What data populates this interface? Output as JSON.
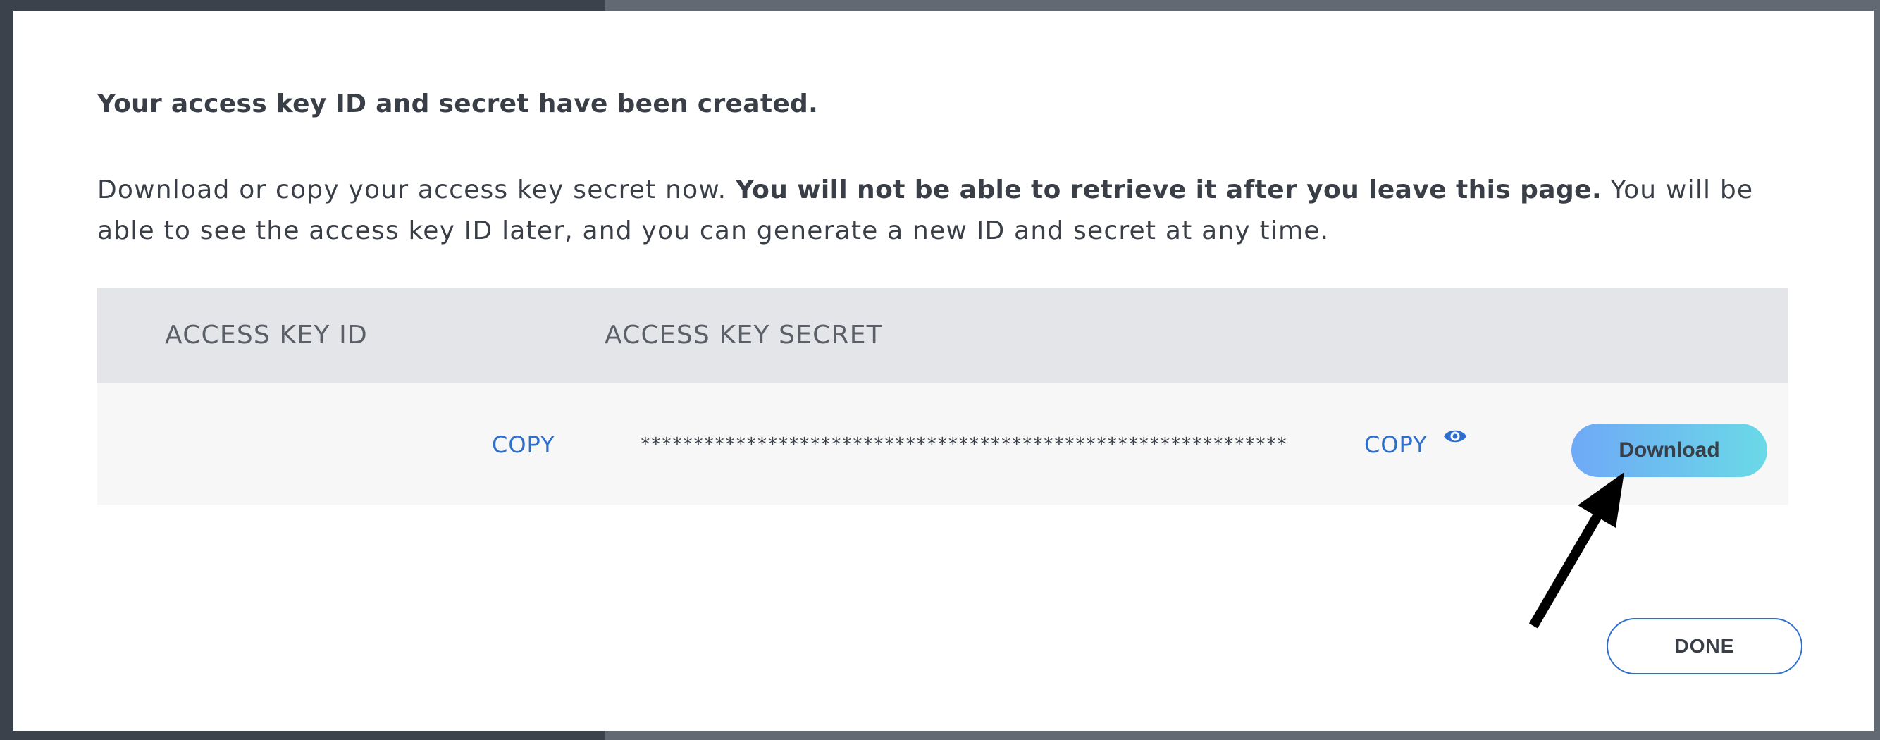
{
  "dialog": {
    "heading": "Your access key ID and secret have been created.",
    "paragraph_part1": "Download or copy your access key secret now. ",
    "paragraph_bold": "You will not be able to retrieve it after you leave this page.",
    "paragraph_part2": " You will be able to see the access key ID later, and you can generate a new ID and secret at any time."
  },
  "table": {
    "headers": {
      "access_key_id": "ACCESS KEY ID",
      "access_key_secret": "ACCESS KEY SECRET"
    },
    "row": {
      "access_key_id_value": "",
      "copy_id_label": "COPY",
      "secret_masked": "*************************************************************",
      "copy_secret_label": "COPY",
      "reveal_icon": "eye-icon",
      "download_label": "Download"
    }
  },
  "footer": {
    "done_label": "DONE"
  },
  "colors": {
    "link": "#2d6fce",
    "header_bg": "#e4e5e9",
    "row_bg": "#f7f7f7",
    "download_gradient_start": "#6fa9f7",
    "download_gradient_end": "#6ad9e6",
    "text": "#3a3f47"
  }
}
